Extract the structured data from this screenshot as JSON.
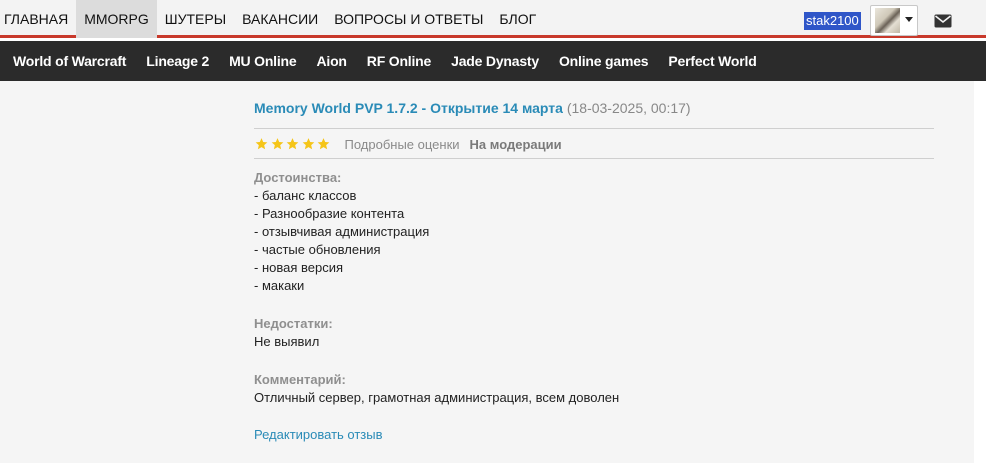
{
  "top_nav": {
    "items": [
      "ГЛАВНАЯ",
      "MMORPG",
      "ШУТЕРЫ",
      "ВАКАНСИИ",
      "ВОПРОСЫ И ОТВЕТЫ",
      "БЛОГ"
    ],
    "active": "MMORPG",
    "username": "stak2100",
    "accent_color": "#c8392b"
  },
  "sub_nav": {
    "items": [
      "World of Warcraft",
      "Lineage 2",
      "MU Online",
      "Aion",
      "RF Online",
      "Jade Dynasty",
      "Online games",
      "Perfect World"
    ]
  },
  "review": {
    "title": "Memory World PVP 1.7.2 - Открытие 14 марта",
    "date": "(18-03-2025, 00:17)",
    "rating": 5,
    "rating_max": 5,
    "detail_link": "Подробные оценки",
    "status": "На модерации",
    "pros_label": "Достоинства:",
    "pros": [
      "- баланс классов",
      "- Разнообразие контента",
      "- отзывчивая администрация",
      "- частые обновления",
      "- новая версия",
      "- макаки"
    ],
    "cons_label": "Недостатки:",
    "cons": [
      "Не выявил"
    ],
    "comment_label": "Комментарий:",
    "comment": "Отличный сервер, грамотная администрация, всем доволен",
    "edit_link": "Редактировать отзыв",
    "link_color": "#2a8bb7",
    "star_color": "#f5c518"
  }
}
